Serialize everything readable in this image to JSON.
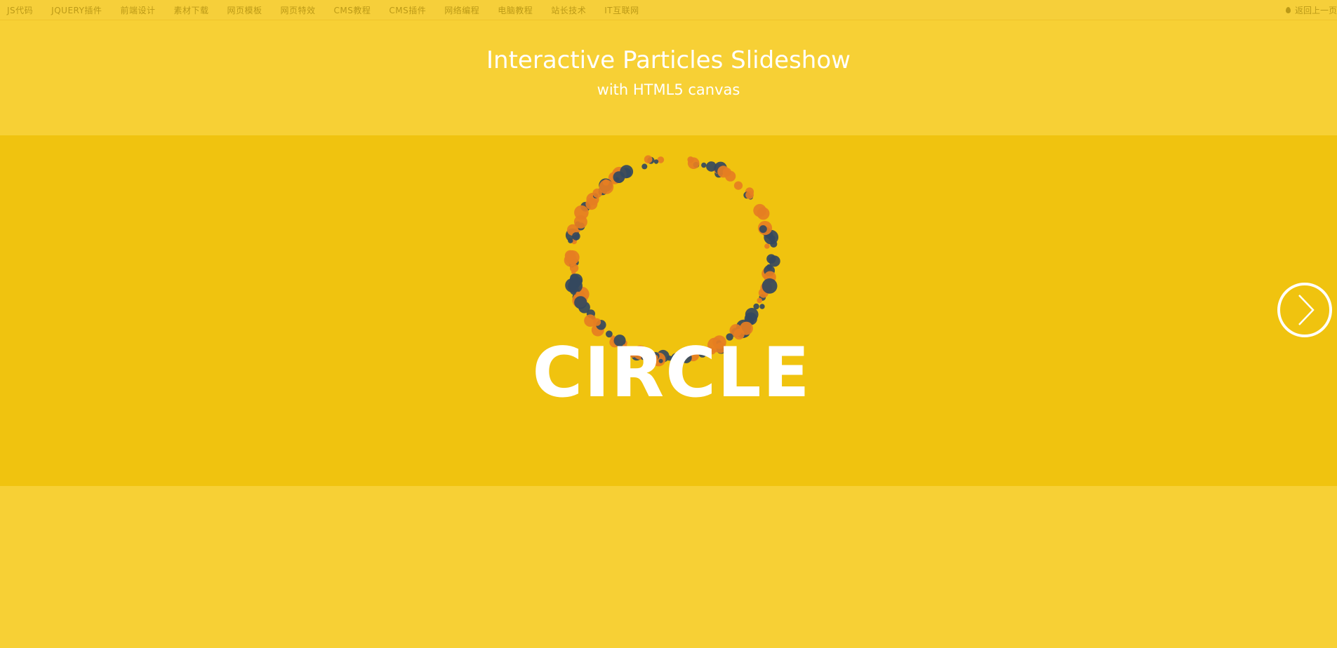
{
  "topnav": {
    "items": [
      "JS代码",
      "JQUERY插件",
      "前端设计",
      "素材下载",
      "网页模板",
      "网页特效",
      "CMS教程",
      "CMS插件",
      "网络编程",
      "电脑教程",
      "站长技术",
      "IT互联网"
    ],
    "back_label": "返回上一页"
  },
  "header": {
    "title": "Interactive Particles Slideshow",
    "subtitle": "with HTML5 canvas"
  },
  "slide": {
    "caption": "CIRCLE",
    "next_icon": "chevron-right-icon"
  },
  "colors": {
    "page_bg": "#f7d035",
    "stage_bg": "#f0c30f",
    "particle_dark": "#34495e",
    "particle_orange": "#e67e22",
    "text": "#ffffff",
    "nav_text": "#bc9a17"
  }
}
